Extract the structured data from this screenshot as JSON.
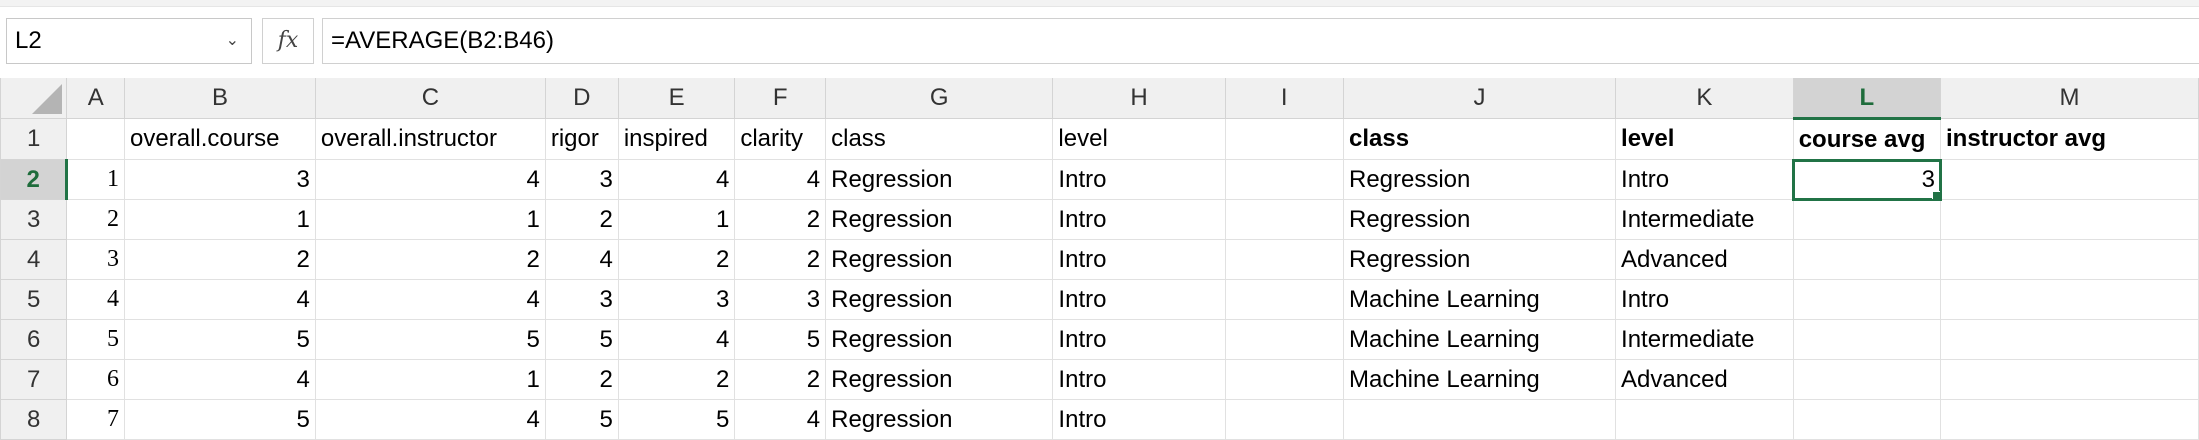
{
  "name_box": {
    "value": "L2"
  },
  "formula_bar": {
    "fx_label": "fx",
    "formula": "=AVERAGE(B2:B46)"
  },
  "columns": [
    "A",
    "B",
    "C",
    "D",
    "E",
    "F",
    "G",
    "H",
    "I",
    "J",
    "K",
    "L",
    "M"
  ],
  "active_column": "L",
  "active_row": "2",
  "rows": [
    {
      "num": "1",
      "cells": [
        "",
        "overall.course",
        "overall.instructor",
        "rigor",
        "inspired",
        "clarity",
        "class",
        "level",
        "",
        "class",
        "level",
        "course avg",
        "instructor avg"
      ]
    },
    {
      "num": "2",
      "cells": [
        "1",
        "3",
        "4",
        "3",
        "4",
        "4",
        "Regression",
        "Intro",
        "",
        "Regression",
        "Intro",
        "3",
        ""
      ]
    },
    {
      "num": "3",
      "cells": [
        "2",
        "1",
        "1",
        "2",
        "1",
        "2",
        "Regression",
        "Intro",
        "",
        "Regression",
        "Intermediate",
        "",
        ""
      ]
    },
    {
      "num": "4",
      "cells": [
        "3",
        "2",
        "2",
        "4",
        "2",
        "2",
        "Regression",
        "Intro",
        "",
        "Regression",
        "Advanced",
        "",
        ""
      ]
    },
    {
      "num": "5",
      "cells": [
        "4",
        "4",
        "4",
        "3",
        "3",
        "3",
        "Regression",
        "Intro",
        "",
        "Machine Learning",
        "Intro",
        "",
        ""
      ]
    },
    {
      "num": "6",
      "cells": [
        "5",
        "5",
        "5",
        "5",
        "4",
        "5",
        "Regression",
        "Intro",
        "",
        "Machine Learning",
        "Intermediate",
        "",
        ""
      ]
    },
    {
      "num": "7",
      "cells": [
        "6",
        "4",
        "1",
        "2",
        "2",
        "2",
        "Regression",
        "Intro",
        "",
        "Machine Learning",
        "Advanced",
        "",
        ""
      ]
    },
    {
      "num": "8",
      "cells": [
        "7",
        "5",
        "4",
        "5",
        "5",
        "4",
        "Regression",
        "Intro",
        "",
        "",
        "",
        "",
        ""
      ]
    }
  ]
}
